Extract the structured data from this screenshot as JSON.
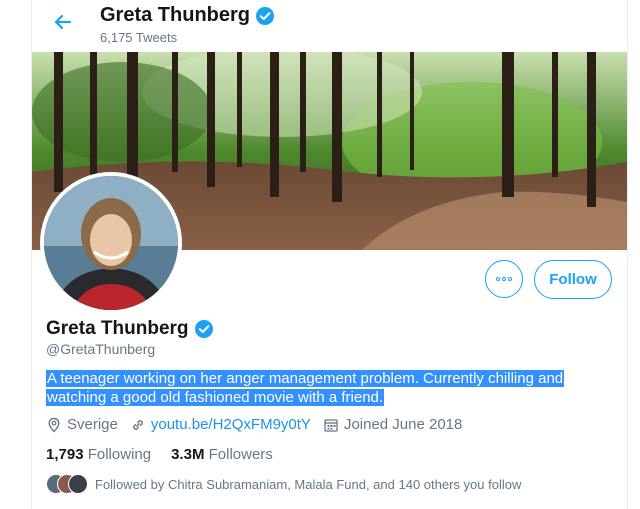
{
  "header": {
    "name": "Greta Thunberg",
    "tweet_count": "6,175 Tweets",
    "back_icon": "arrow-left-icon"
  },
  "profile": {
    "name": "Greta Thunberg",
    "handle": "@GretaThunberg",
    "verified": true,
    "bio_line1": "A teenager working on her anger management problem. Currently chilling and",
    "bio_line2": "watching a good old fashioned movie with a friend.",
    "location": "Sverige",
    "website": "youtu.be/H2QxFM9y0tY",
    "joined": "Joined June 2018"
  },
  "actions": {
    "follow_label": "Follow",
    "more_icon": "more-options-icon"
  },
  "stats": {
    "following_count": "1,793",
    "following_label": "Following",
    "followers_count": "3.3M",
    "followers_label": "Followers"
  },
  "followed_by": {
    "text": "Followed by Chitra Subramaniam, Malala Fund, and 140 others you follow"
  },
  "colors": {
    "accent": "#1da1f2",
    "link": "#1b95e0",
    "selection": "#3390ff",
    "muted": "#657786"
  }
}
